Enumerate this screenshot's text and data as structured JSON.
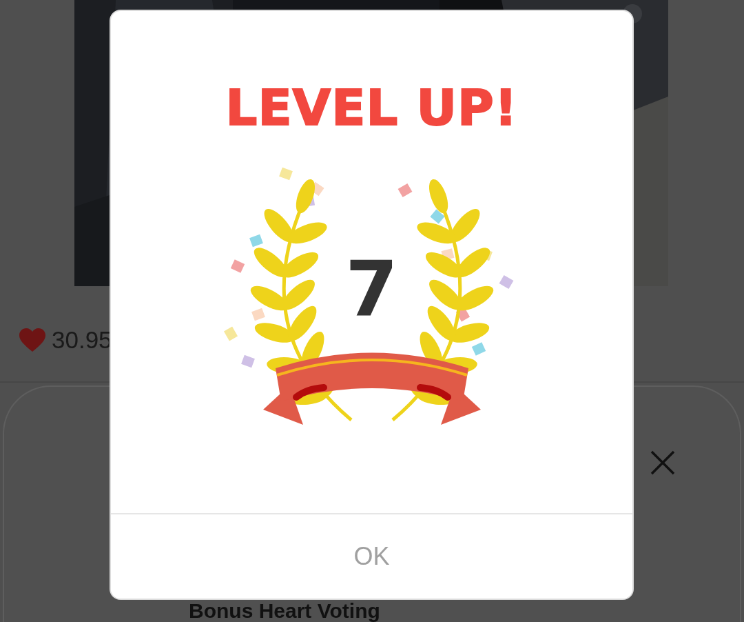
{
  "background": {
    "likes": "30.95",
    "sheet_title": "Bonus Heart Voting"
  },
  "dialog": {
    "title": "LEVEL UP!",
    "level": "7",
    "button": "OK"
  }
}
